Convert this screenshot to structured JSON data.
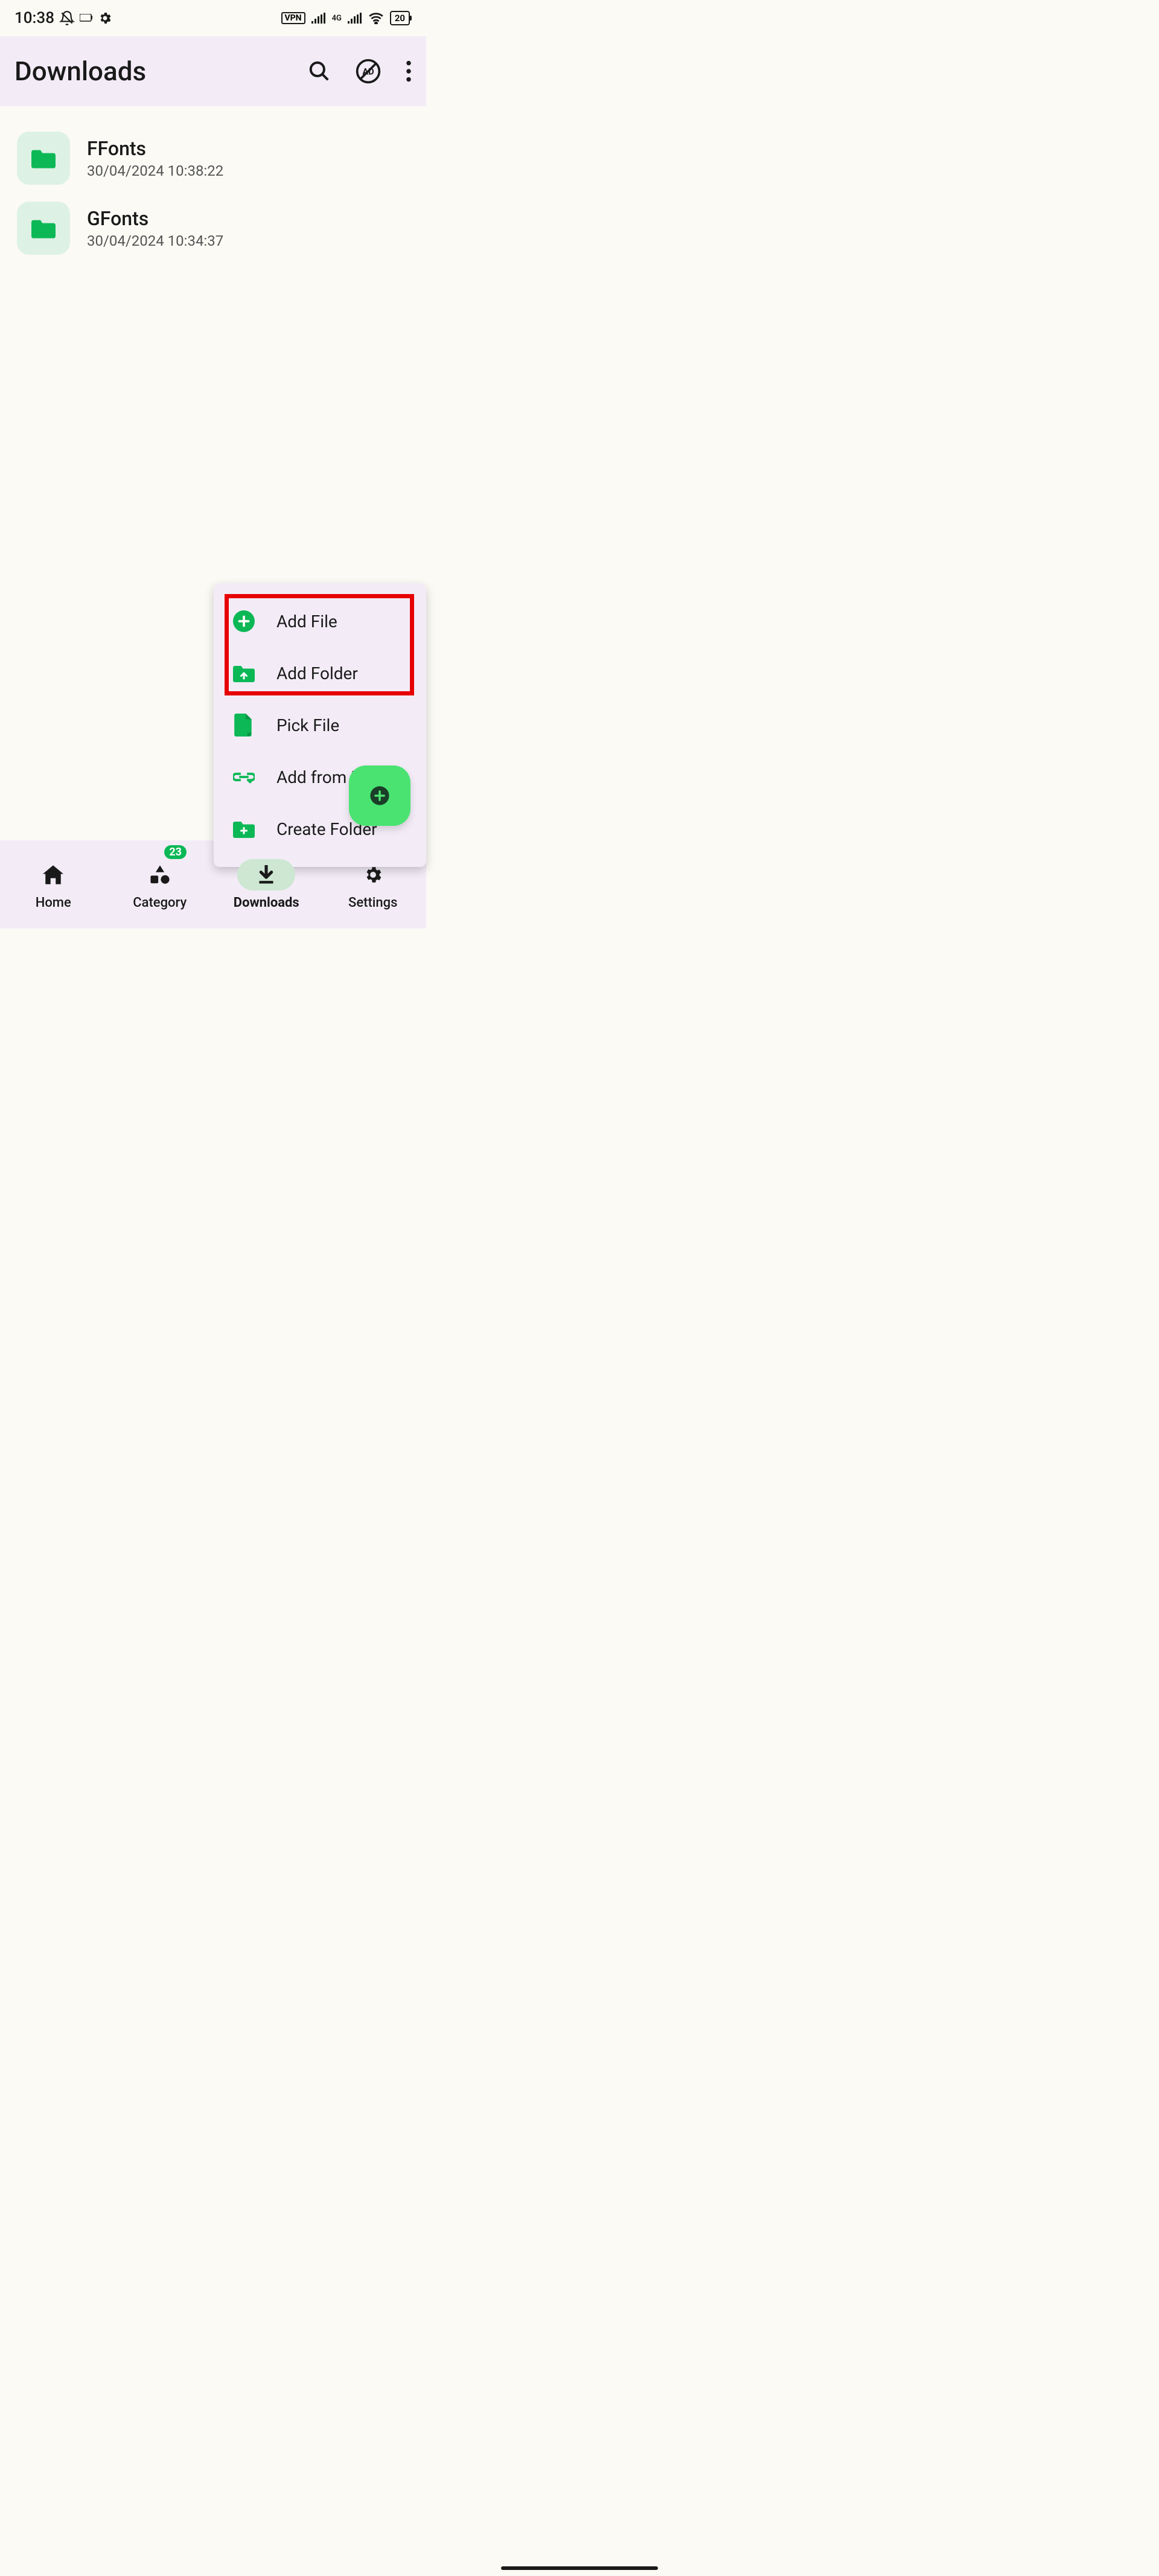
{
  "status": {
    "time": "10:38",
    "battery": "20",
    "network": "4G",
    "vpn": "VPN"
  },
  "app_bar": {
    "title": "Downloads"
  },
  "folders": [
    {
      "name": "FFonts",
      "date": "30/04/2024 10:38:22"
    },
    {
      "name": "GFonts",
      "date": "30/04/2024 10:34:37"
    }
  ],
  "menu": {
    "add_file": "Add File",
    "add_folder": "Add Folder",
    "pick_file": "Pick File",
    "add_from_link": "Add from Link",
    "create_folder": "Create Folder"
  },
  "nav": {
    "home": "Home",
    "category": "Category",
    "category_badge": "23",
    "downloads": "Downloads",
    "settings": "Settings"
  }
}
